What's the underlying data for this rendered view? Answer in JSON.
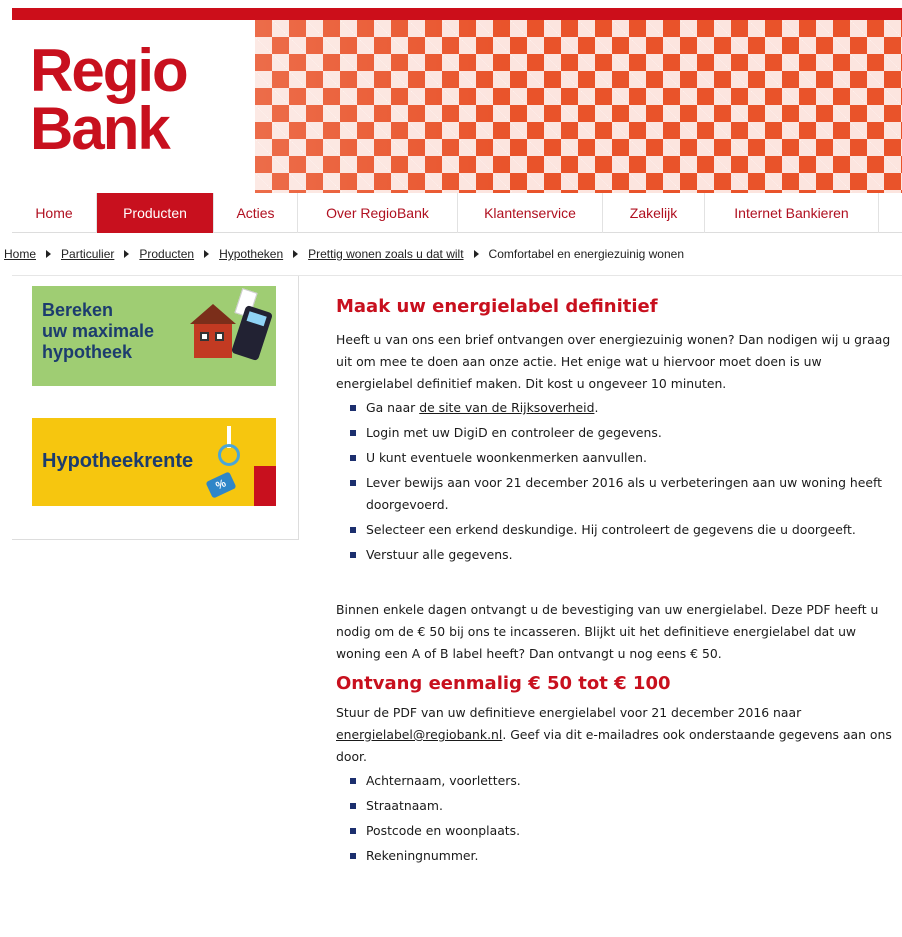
{
  "brand": {
    "line1": "Regio",
    "line2": "Bank"
  },
  "nav": [
    {
      "label": "Home"
    },
    {
      "label": "Producten"
    },
    {
      "label": "Acties"
    },
    {
      "label": "Over RegioBank"
    },
    {
      "label": "Klantenservice"
    },
    {
      "label": "Zakelijk"
    },
    {
      "label": "Internet Bankieren"
    }
  ],
  "breadcrumb": [
    "Home",
    "Particulier",
    "Producten",
    "Hypotheken",
    "Prettig wonen zoals u dat wilt",
    "Comfortabel en energiezuinig wonen"
  ],
  "sidebar": {
    "banner1": {
      "line1": "Bereken",
      "line2": "uw maximale",
      "line3": "hypotheek"
    },
    "banner2": {
      "label": "Hypotheekrente",
      "tag": "%"
    }
  },
  "content": {
    "title1": "Maak uw energielabel definitief",
    "intro": "Heeft u van ons een brief ontvangen over energiezuinig wonen? Dan nodigen wij u graag uit om mee te doen aan onze actie. Het enige wat u hiervoor moet doen is uw energielabel definitief maken. Dit kost u ongeveer 10 minuten.",
    "steps_first_prefix": "Ga naar ",
    "steps_first_link": "de site van de Rijksoverheid",
    "steps_first_suffix": ".",
    "steps": [
      "Login met uw DigiD en controleer de gegevens.",
      "U kunt eventuele woonkenmerken aanvullen.",
      "Lever bewijs aan voor 21 december 2016 als u verbeteringen aan uw woning heeft doorgevoerd.",
      "Selecteer een erkend deskundige. Hij controleert de gegevens die u doorgeeft.",
      "Verstuur alle gegevens."
    ],
    "para2": "Binnen enkele dagen ontvangt u de bevestiging van uw energielabel. Deze PDF heeft u nodig om de € 50 bij ons te incasseren. Blijkt uit het definitieve energielabel dat uw woning een A of B label heeft? Dan ontvangt u nog eens € 50.",
    "title2": "Ontvang eenmalig € 50 tot € 100",
    "para3_prefix": "Stuur de PDF van uw definitieve energielabel voor 21 december 2016 naar ",
    "para3_link": "energielabel@regiobank.nl",
    "para3_suffix": ". Geef via dit e-mailadres ook onderstaande gegevens aan ons door.",
    "details": [
      "Achternaam, voorletters.",
      "Straatnaam.",
      "Postcode en woonplaats.",
      "Rekeningnummer."
    ]
  },
  "colors": {
    "brand_red": "#c8101e",
    "bullet_navy": "#1c2f6e",
    "green": "#9fcd73",
    "yellow": "#f6c60f"
  }
}
